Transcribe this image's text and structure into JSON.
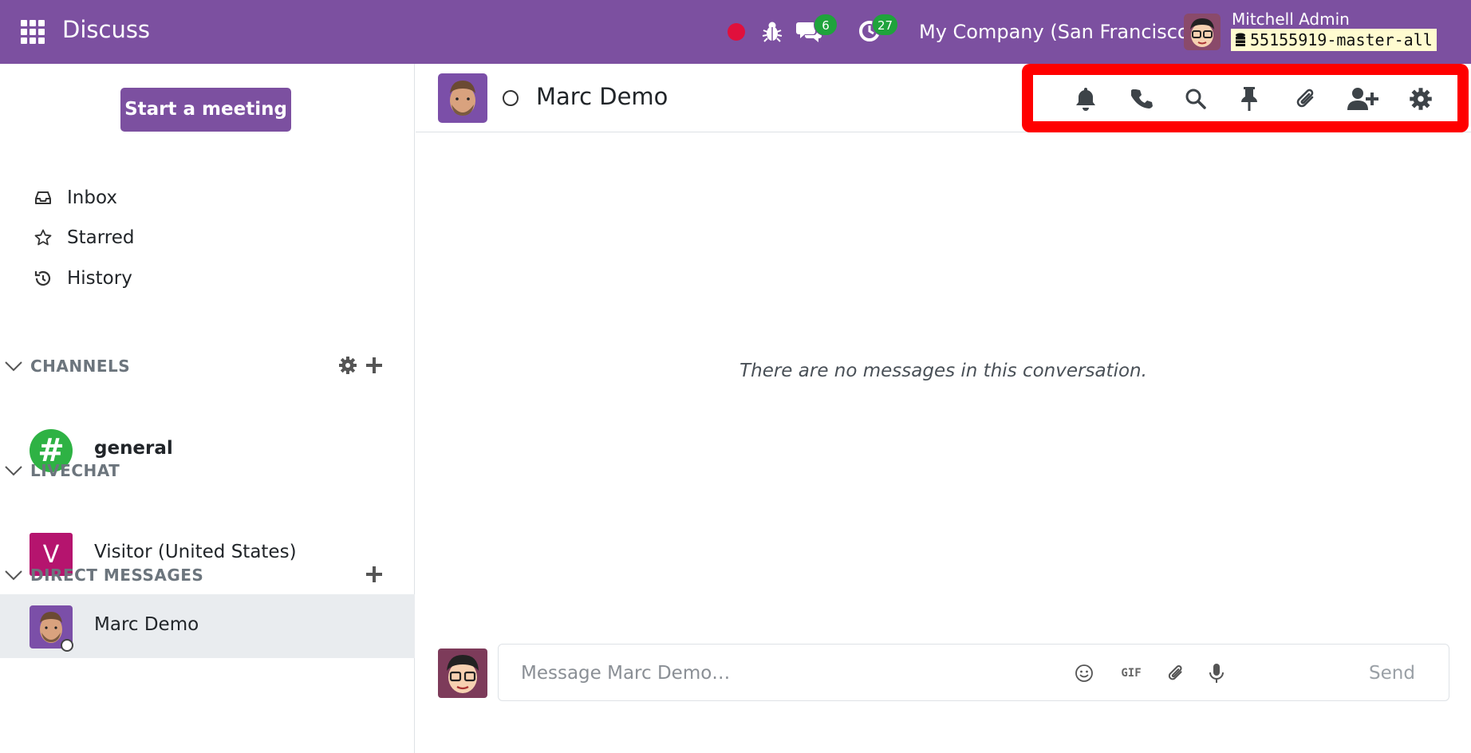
{
  "navbar": {
    "app_name": "Discuss",
    "messages_badge": "6",
    "activities_badge": "27",
    "company": "My Company (San Francisco)",
    "user_name": "Mitchell Admin",
    "database": "55155919-master-all",
    "icons": [
      "apps-grid-icon",
      "recording-dot-icon",
      "bug-icon",
      "chat-bubbles-icon",
      "clock-icon"
    ]
  },
  "sidebar": {
    "start_meeting_label": "Start a meeting",
    "mailboxes": [
      {
        "label": "Inbox",
        "icon": "inbox-icon"
      },
      {
        "label": "Starred",
        "icon": "star-icon"
      },
      {
        "label": "History",
        "icon": "history-icon"
      }
    ],
    "channels_title": "CHANNELS",
    "channels": [
      {
        "label": "general",
        "avatar": "#"
      }
    ],
    "livechat_title": "LIVECHAT",
    "livechats": [
      {
        "label": "Visitor (United States)",
        "avatar": "V"
      }
    ],
    "dm_title": "DIRECT MESSAGES",
    "direct_messages": [
      {
        "label": "Marc Demo",
        "active": true
      }
    ]
  },
  "thread": {
    "name": "Marc Demo",
    "empty_text": "There are no messages in this conversation.",
    "header_tools": [
      "bell-icon",
      "phone-icon",
      "search-icon",
      "pin-icon",
      "paperclip-icon",
      "add-user-icon",
      "gear-icon"
    ]
  },
  "composer": {
    "placeholder": "Message Marc Demo…",
    "gif_label": "GIF",
    "send_label": "Send"
  },
  "colors": {
    "brand": "#7c50a0",
    "highlight": "#ff0000",
    "badge": "#1fa33c",
    "general_channel": "#2eb244",
    "visitor_avatar": "#b5146e"
  }
}
